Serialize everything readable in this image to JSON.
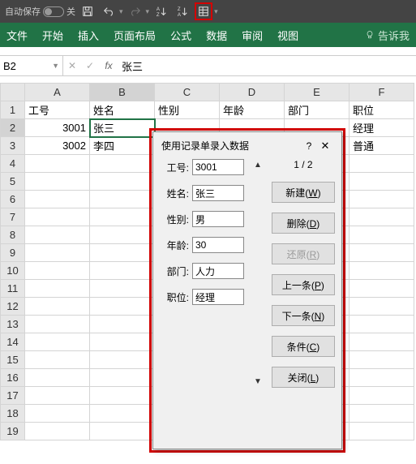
{
  "titlebar": {
    "autosave_label": "自动保存",
    "autosave_state": "关"
  },
  "ribbon": {
    "tabs": [
      "文件",
      "开始",
      "插入",
      "页面布局",
      "公式",
      "数据",
      "审阅",
      "视图"
    ],
    "tell_me": "告诉我"
  },
  "formula_bar": {
    "name_box": "B2",
    "formula": "张三"
  },
  "sheet": {
    "columns": [
      "A",
      "B",
      "C",
      "D",
      "E",
      "F"
    ],
    "headers": [
      "工号",
      "姓名",
      "性别",
      "年龄",
      "部门",
      "职位"
    ],
    "rows": [
      {
        "工号": "3001",
        "姓名": "张三",
        "性别": "",
        "年龄": "",
        "部门": "",
        "职位": "经理"
      },
      {
        "工号": "3002",
        "姓名": "李四",
        "性别": "",
        "年龄": "",
        "部门": "",
        "职位": "普通"
      }
    ]
  },
  "dialog": {
    "title": "使用记录单录入数据",
    "help": "?",
    "counter": "1 / 2",
    "fields": {
      "id_label": "工号:",
      "id_value": "3001",
      "name_label": "姓名:",
      "name_value": "张三",
      "gender_label": "性别:",
      "gender_value": "男",
      "age_label": "年龄:",
      "age_value": "30",
      "dept_label": "部门:",
      "dept_value": "人力",
      "pos_label": "职位:",
      "pos_value": "经理"
    },
    "buttons": {
      "new_": "新建(",
      "new_key": "W",
      "close_paren": ")",
      "delete_": "删除(",
      "delete_key": "D",
      "restore_": "还原(",
      "restore_key": "R",
      "prev_": "上一条(",
      "prev_key": "P",
      "next_": "下一条(",
      "next_key": "N",
      "criteria_": "条件(",
      "criteria_key": "C",
      "close_": "关闭(",
      "close_key": "L"
    }
  }
}
